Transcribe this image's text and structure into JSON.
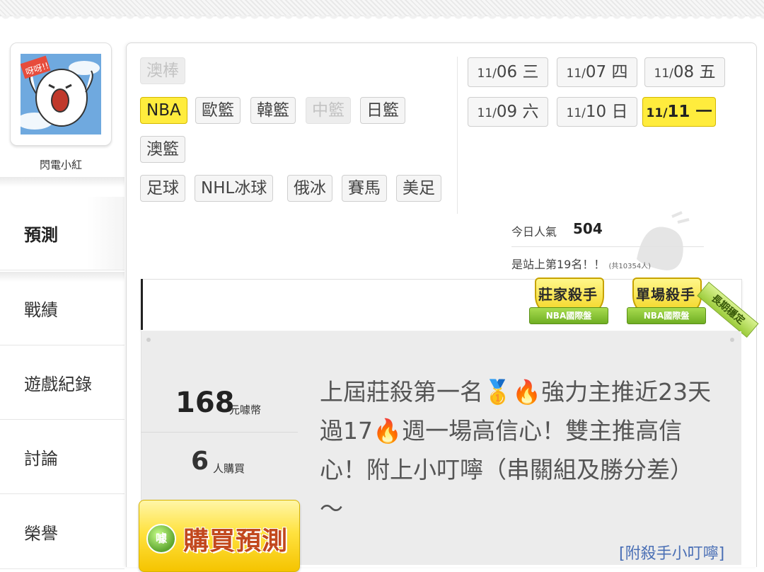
{
  "profile": {
    "name": "閃電小紅"
  },
  "nav": {
    "items": [
      {
        "label": "預測",
        "active": true
      },
      {
        "label": "戰績"
      },
      {
        "label": "遊戲紀錄"
      },
      {
        "label": "討論"
      },
      {
        "label": "榮譽"
      }
    ]
  },
  "sports": [
    {
      "label": "澳棒",
      "state": "disabled"
    },
    {
      "label": "NBA",
      "state": "active"
    },
    {
      "label": "歐籃"
    },
    {
      "label": "韓籃"
    },
    {
      "label": "中籃",
      "state": "disabled"
    },
    {
      "label": "日籃"
    },
    {
      "label": "澳籃"
    },
    {
      "label": "足球"
    },
    {
      "label": "NHL冰球"
    },
    {
      "label": "俄冰"
    },
    {
      "label": "賽馬"
    },
    {
      "label": "美足"
    }
  ],
  "dates": [
    {
      "month": "11/",
      "day": "06",
      "weekday": "三"
    },
    {
      "month": "11/",
      "day": "07",
      "weekday": "四"
    },
    {
      "month": "11/",
      "day": "08",
      "weekday": "五"
    },
    {
      "month": "11/",
      "day": "09",
      "weekday": "六"
    },
    {
      "month": "11/",
      "day": "10",
      "weekday": "日"
    },
    {
      "month": "11/",
      "day": "11",
      "weekday": "一",
      "active": true
    }
  ],
  "stats": {
    "popularity_label": "今日人氣",
    "popularity_value": "504",
    "rank_text": "是站上第19名！！",
    "rank_total": "(共10354人)"
  },
  "badges": [
    {
      "title": "莊家殺手",
      "subtitle": "NBA國際盤"
    },
    {
      "title": "單場殺手",
      "subtitle": "NBA國際盤"
    }
  ],
  "corner_ribbon": "長期穩定",
  "prediction": {
    "price": "168",
    "price_unit": "元噱幣",
    "buyers": "6",
    "buyers_unit": "人購買",
    "buy_icon_text": "噱",
    "buy_label": "購買預測",
    "description": "上屆莊殺第一名🥇🔥強力主推近23天過17🔥週一場高信心！雙主推高信心！附上小叮嚀（串關組及勝分差）～",
    "link": "[附殺手小叮嚀]"
  },
  "colors": {
    "accent_yellow": "#ffec3d",
    "link_blue": "#4a6fb5",
    "buy_text": "#c2481d"
  }
}
